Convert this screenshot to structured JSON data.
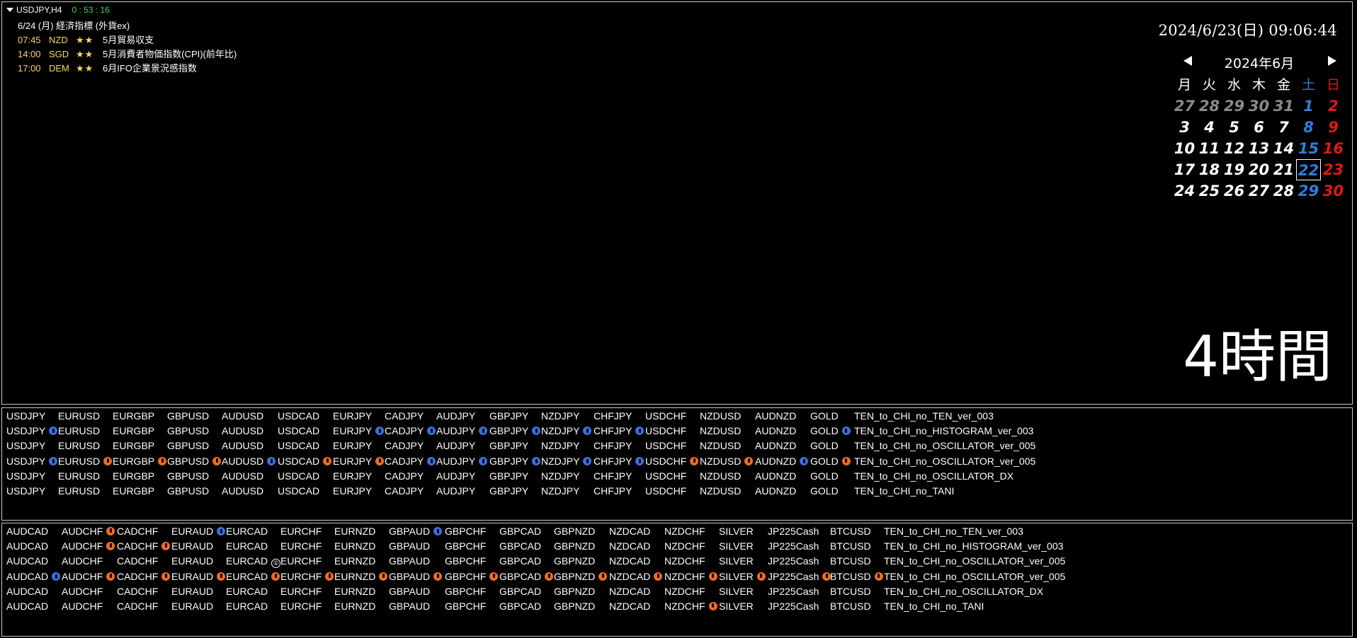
{
  "chart": {
    "symbol": "USDJPY,H4",
    "countdown": "0 : 53 : 16",
    "calendar_header": "6/24 (月) 経済指標 (外貨ex)",
    "events": [
      {
        "time": "07:45",
        "currency": "NZD",
        "stars": "★★",
        "title": "5月貿易収支"
      },
      {
        "time": "14:00",
        "currency": "SGD",
        "stars": "★★",
        "title": "5月消費者物価指数(CPI)(前年比)"
      },
      {
        "time": "17:00",
        "currency": "DEM",
        "stars": "★★",
        "title": "6月IFO企業景況感指数"
      }
    ],
    "clock": "2024/6/23(日) 09:06:44",
    "timeframe_label": "4時間",
    "colors": {
      "accent_yellow": "#f5d66b",
      "timer_green": "#3ed63e",
      "up_signal": "#3a6fe0",
      "down_signal": "#f06a24",
      "saturday": "#2f7fd9",
      "sunday": "#e01818"
    }
  },
  "calendar": {
    "month_title": "2024年6月",
    "prev_icon": "triangle-left-icon",
    "next_icon": "triangle-right-icon",
    "weekdays": [
      "月",
      "火",
      "水",
      "木",
      "金",
      "土",
      "日"
    ],
    "weeks": [
      [
        "27",
        "28",
        "29",
        "30",
        "31",
        "1",
        "2"
      ],
      [
        "3",
        "4",
        "5",
        "6",
        "7",
        "8",
        "9"
      ],
      [
        "10",
        "11",
        "12",
        "13",
        "14",
        "15",
        "16"
      ],
      [
        "17",
        "18",
        "19",
        "20",
        "21",
        "22",
        "23"
      ],
      [
        "24",
        "25",
        "26",
        "27",
        "28",
        "29",
        "30"
      ]
    ],
    "leading_other_month_days": 5,
    "today": "22"
  },
  "panel1": {
    "symbols": [
      "USDJPY",
      "EURUSD",
      "EURGBP",
      "GBPUSD",
      "AUDUSD",
      "USDCAD",
      "EURJPY",
      "CADJPY",
      "AUDJPY",
      "GBPJPY",
      "NZDJPY",
      "CHFJPY",
      "USDCHF",
      "NZDUSD",
      "AUDNZD",
      "GOLD"
    ],
    "rows": [
      {
        "indicator": "TEN_to_CHI_no_TEN_ver_003",
        "signals": [
          "",
          "",
          "",
          "",
          "",
          "",
          "",
          "",
          "",
          "",
          "",
          "",
          "",
          "",
          "",
          ""
        ]
      },
      {
        "indicator": "TEN_to_CHI_no_HISTOGRAM_ver_003",
        "signals": [
          "up",
          "",
          "",
          "",
          "",
          "",
          "up",
          "up",
          "up",
          "up",
          "up",
          "up",
          "",
          "",
          "",
          "up"
        ]
      },
      {
        "indicator": "TEN_to_CHI_no_OSCILLATOR_ver_005",
        "signals": [
          "",
          "",
          "",
          "",
          "",
          "",
          "",
          "",
          "",
          "",
          "",
          "",
          "",
          "",
          "",
          ""
        ]
      },
      {
        "indicator": "TEN_to_CHI_no_OSCILLATOR_ver_005",
        "signals": [
          "up",
          "dn",
          "dn",
          "dn",
          "up",
          "dn",
          "dn",
          "up",
          "up",
          "up",
          "up",
          "up",
          "dn",
          "dn",
          "up",
          "dn"
        ]
      },
      {
        "indicator": "TEN_to_CHI_no_OSCILLATOR_DX",
        "signals": [
          "",
          "",
          "",
          "",
          "",
          "",
          "",
          "",
          "",
          "",
          "",
          "",
          "",
          "",
          "",
          ""
        ]
      },
      {
        "indicator": "TEN_to_CHI_no_TANI",
        "signals": [
          "",
          "",
          "",
          "",
          "",
          "",
          "",
          "",
          "",
          "",
          "",
          "",
          "",
          "",
          "",
          ""
        ]
      }
    ]
  },
  "panel2": {
    "symbols": [
      "AUDCAD",
      "AUDCHF",
      "CADCHF",
      "EURAUD",
      "EURCAD",
      "EURCHF",
      "EURNZD",
      "GBPAUD",
      "GBPCHF",
      "GBPCAD",
      "GBPNZD",
      "NZDCAD",
      "NZDCHF",
      "SILVER",
      "JP225Cash",
      "BTCUSD"
    ],
    "rows": [
      {
        "indicator": "TEN_to_CHI_no_TEN_ver_003",
        "signals": [
          "",
          "dn",
          "",
          "up",
          "",
          "",
          "",
          "up",
          "",
          "",
          "",
          "",
          "",
          "",
          "",
          ""
        ]
      },
      {
        "indicator": "TEN_to_CHI_no_HISTOGRAM_ver_003",
        "signals": [
          "",
          "dn",
          "dn",
          "",
          "",
          "",
          "",
          "",
          "",
          "",
          "",
          "",
          "",
          "",
          "",
          ""
        ]
      },
      {
        "indicator": "TEN_to_CHI_no_OSCILLATOR_ver_005",
        "signals": [
          "",
          "",
          "",
          "",
          "one",
          "",
          "",
          "",
          "",
          "",
          "",
          "",
          "",
          "",
          "",
          ""
        ]
      },
      {
        "indicator": "TEN_to_CHI_no_OSCILLATOR_ver_005",
        "signals": [
          "up",
          "dn",
          "dn",
          "dn",
          "dn",
          "dn",
          "dn",
          "dn",
          "dn",
          "dn",
          "dn",
          "dn",
          "dn",
          "dn",
          "dn",
          "dn"
        ]
      },
      {
        "indicator": "TEN_to_CHI_no_OSCILLATOR_DX",
        "signals": [
          "",
          "",
          "",
          "",
          "",
          "",
          "",
          "",
          "",
          "",
          "",
          "",
          "",
          "",
          "",
          ""
        ]
      },
      {
        "indicator": "TEN_to_CHI_no_TANI",
        "signals": [
          "",
          "",
          "",
          "",
          "",
          "",
          "",
          "",
          "",
          "",
          "",
          "",
          "dn",
          "",
          "",
          ""
        ]
      }
    ],
    "one_mark": "①"
  }
}
